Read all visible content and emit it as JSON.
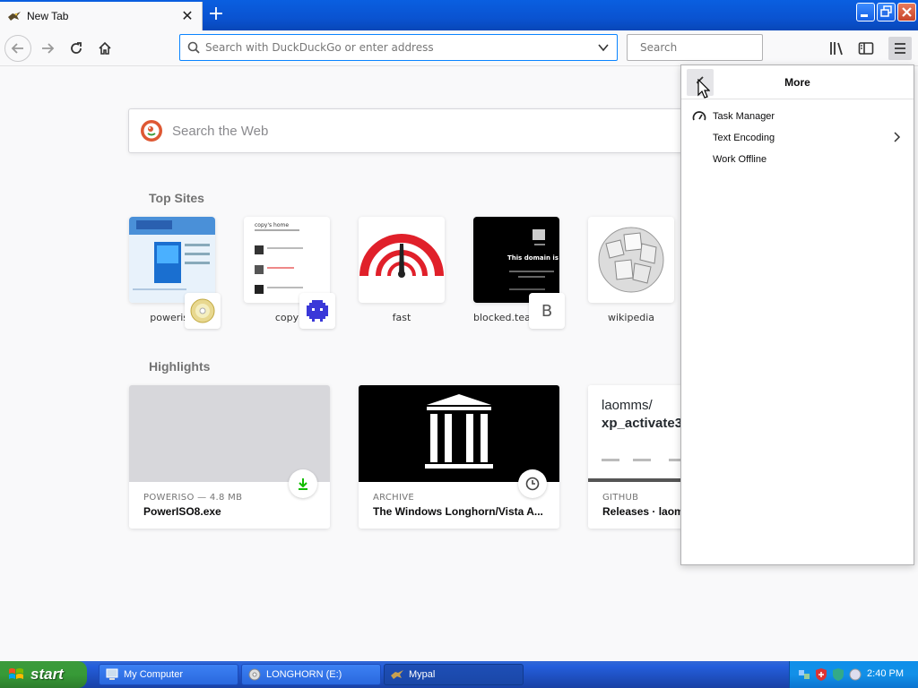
{
  "browser": {
    "tab": {
      "title": "New Tab",
      "close_symbol": "✕"
    },
    "new_tab_symbol": "+",
    "urlbar": {
      "placeholder": "Search with DuckDuckGo or enter address"
    },
    "searchbar": {
      "placeholder": "Search"
    },
    "accent_color": "#0a84ff",
    "icons": [
      "back-icon",
      "forward-icon",
      "reload-icon",
      "home-icon",
      "library-icon",
      "sidebar-icon",
      "hamburger-menu-icon"
    ]
  },
  "newtab": {
    "web_search": {
      "placeholder": "Search the Web"
    },
    "top_sites_title": "Top Sites",
    "top_sites": [
      {
        "label": "poweriso"
      },
      {
        "label": "copy"
      },
      {
        "label": "fast"
      },
      {
        "label": "blocked.teams.clo…",
        "badge": "B",
        "thumb_text": "This domain is blo"
      },
      {
        "label": "wikipedia"
      }
    ],
    "copy_thumb": {
      "heading": "copy's home"
    },
    "highlights_title": "Highlights",
    "highlights": [
      {
        "meta": "POWERISO — 4.8 MB",
        "title": "PowerISO8.exe"
      },
      {
        "meta": "ARCHIVE",
        "title": "The Windows Longhorn/Vista A..."
      },
      {
        "meta": "GITHUB",
        "title": "Releases · laom",
        "thumb_line1": "laomms/",
        "thumb_line2": "xp_activate3"
      }
    ]
  },
  "more_panel": {
    "title": "More",
    "items": [
      {
        "label": "Task Manager"
      },
      {
        "label": "Text Encoding"
      },
      {
        "label": "Work Offline"
      }
    ]
  },
  "taskbar": {
    "start_label": "start",
    "tasks": [
      {
        "label": "My Computer"
      },
      {
        "label": "LONGHORN (E:)"
      },
      {
        "label": "Mypal"
      }
    ],
    "clock": "2:40 PM"
  }
}
